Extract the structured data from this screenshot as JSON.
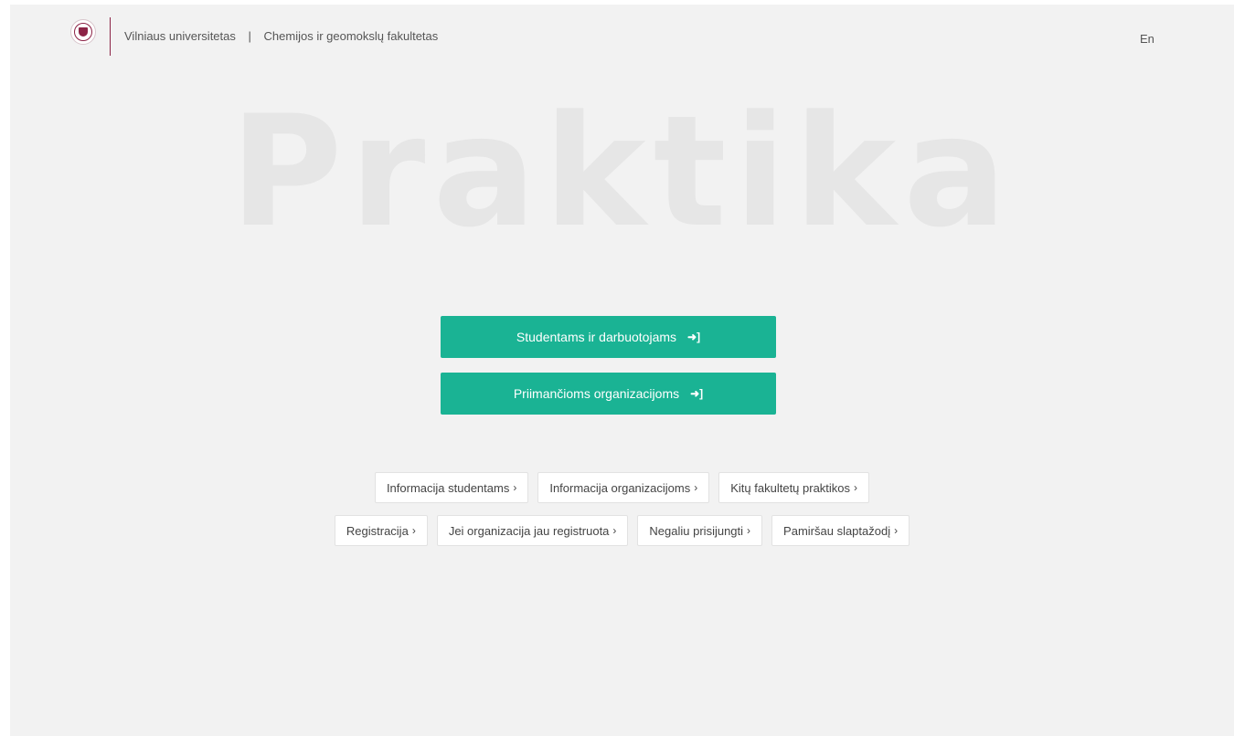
{
  "header": {
    "university": "Vilniaus universitetas",
    "separator": "|",
    "faculty": "Chemijos ir geomokslų fakultetas",
    "language_link": "En"
  },
  "hero": {
    "title": "Praktika"
  },
  "main_buttons": [
    {
      "label": "Studentams ir darbuotojams",
      "icon": "sign-in-icon"
    },
    {
      "label": "Priimančioms organizacijoms",
      "icon": "sign-in-icon"
    }
  ],
  "links_row1": [
    {
      "label": "Informacija studentams",
      "chevron": "›"
    },
    {
      "label": "Informacija organizacijoms",
      "chevron": "›"
    },
    {
      "label": "Kitų fakultetų praktikos",
      "chevron": "›"
    }
  ],
  "links_row2": [
    {
      "label": "Registracija",
      "chevron": "›"
    },
    {
      "label": "Jei organizacija jau registruota",
      "chevron": "›"
    },
    {
      "label": "Negaliu prisijungti",
      "chevron": "›"
    },
    {
      "label": "Pamiršau slaptažodį",
      "chevron": "›"
    }
  ],
  "colors": {
    "accent": "#1ab394",
    "brand": "#8c2346",
    "background": "#f2f2f2",
    "hero_text": "#e6e6e6"
  }
}
